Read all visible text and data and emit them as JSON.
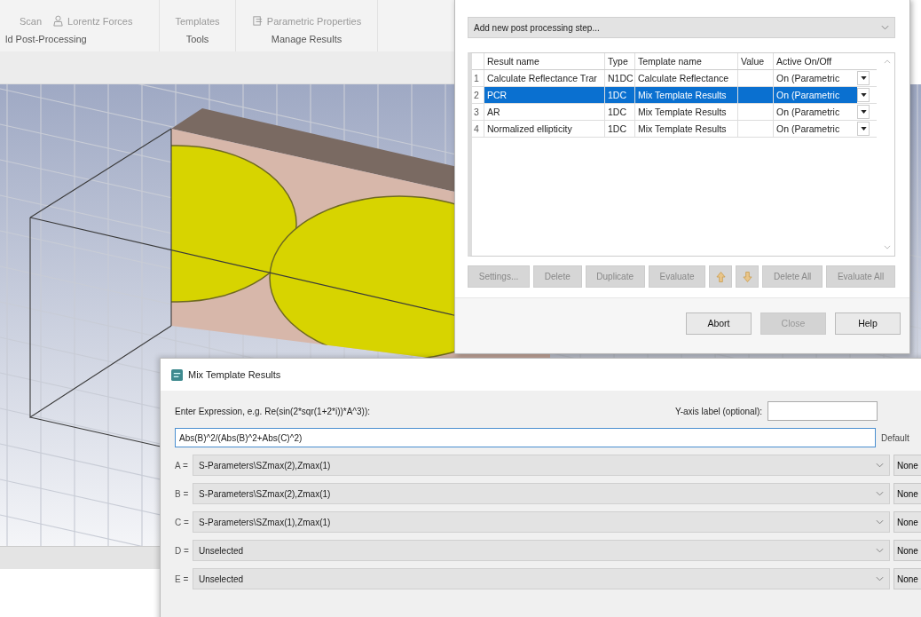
{
  "ribbon": {
    "items": [
      {
        "label": "Scan",
        "kind": "text"
      },
      {
        "label": "Lorentz Forces",
        "kind": "figure"
      },
      {
        "label": "Templates",
        "kind": "text"
      },
      {
        "label": "Parametric Properties",
        "kind": "properties"
      }
    ],
    "groups": [
      "ld Post-Processing",
      "Tools",
      "Manage Results"
    ]
  },
  "post_processing": {
    "step_dropdown": "Add new post processing step...",
    "table": {
      "columns": [
        "Result name",
        "Type",
        "Template name",
        "Value",
        "Active On/Off"
      ],
      "rows": [
        {
          "number": "1",
          "result_name": "Calculate Reflectance Trar",
          "type": "N1DC",
          "template_name": "Calculate Reflectance",
          "active": "On (Parametric",
          "selected": false
        },
        {
          "number": "2",
          "result_name": "PCR",
          "type": "1DC",
          "template_name": "Mix Template Results",
          "active": "On (Parametric",
          "selected": true
        },
        {
          "number": "3",
          "result_name": "AR",
          "type": "1DC",
          "template_name": "Mix Template Results",
          "active": "On (Parametric",
          "selected": false
        },
        {
          "number": "4",
          "result_name": "Normalized ellipticity",
          "type": "1DC",
          "template_name": "Mix Template Results",
          "active": "On (Parametric",
          "selected": false
        }
      ]
    },
    "buttons": [
      {
        "kind": "text",
        "label": "Settings...",
        "disabled": true
      },
      {
        "kind": "text",
        "label": "Delete",
        "disabled": true
      },
      {
        "kind": "text",
        "label": "Duplicate",
        "disabled": true
      },
      {
        "kind": "text",
        "label": "Evaluate",
        "disabled": true
      },
      {
        "kind": "move-up",
        "disabled": true
      },
      {
        "kind": "move-down",
        "disabled": true
      },
      {
        "kind": "text",
        "label": "Delete All",
        "disabled": true
      },
      {
        "kind": "text",
        "label": "Evaluate All",
        "disabled": true
      }
    ],
    "footer_buttons": [
      {
        "label": "Abort",
        "disabled": false
      },
      {
        "label": "Close",
        "disabled": true
      },
      {
        "label": "Help",
        "disabled": false
      }
    ]
  },
  "mix_dialog": {
    "title": "Mix Template Results",
    "expression_label": "Enter Expression, e.g. Re(sin(2*sqr(1+2*i))*A^3)):",
    "y_axis_label": "Y-axis label (optional):",
    "expression": "Abs(B)^2/(Abs(B)^2+Abs(C)^2)",
    "default_label": "Default",
    "variables": [
      {
        "name": "A =",
        "value": "S-Parameters\\SZmax(2),Zmax(1)",
        "button": "None"
      },
      {
        "name": "B =",
        "value": "S-Parameters\\SZmax(2),Zmax(1)",
        "button": "None"
      },
      {
        "name": "C =",
        "value": "S-Parameters\\SZmax(1),Zmax(1)",
        "button": "None"
      },
      {
        "name": "D =",
        "value": "Unselected",
        "button": "None"
      },
      {
        "name": "E =",
        "value": "Unselected",
        "button": "None"
      }
    ]
  }
}
